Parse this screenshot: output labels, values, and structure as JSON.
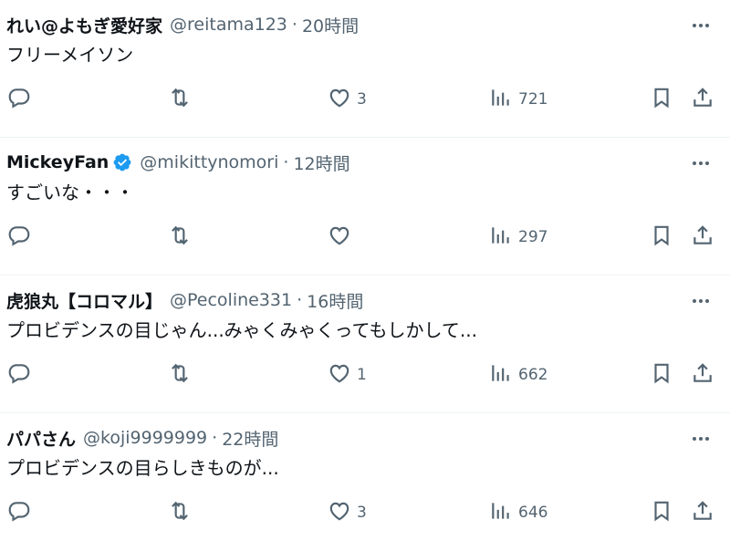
{
  "replies": [
    {
      "name": "れい@よもぎ愛好家",
      "verified": false,
      "handle": "@reitama123",
      "time": "20時間",
      "text": "フリーメイソン",
      "likes": "3",
      "views": "721"
    },
    {
      "name": "MickeyFan",
      "verified": true,
      "handle": "@mikittynomori",
      "time": "12時間",
      "text": "すごいな・・・",
      "likes": "",
      "views": "297"
    },
    {
      "name": "虎狼丸【コロマル】",
      "verified": false,
      "handle": "@Pecoline331",
      "time": "16時間",
      "text": "プロビデンスの目じゃん...みゃくみゃくってもしかして...",
      "likes": "1",
      "views": "662"
    },
    {
      "name": "パパさん",
      "verified": false,
      "handle": "@koji9999999",
      "time": "22時間",
      "text": "プロビデンスの目らしきものが...",
      "likes": "3",
      "views": "646"
    }
  ],
  "separator": "·",
  "colors": {
    "text": "#0f1419",
    "muted": "#536471",
    "verified": "#1d9bf0",
    "divider": "#eff3f4"
  },
  "icons": {
    "more": "more-icon",
    "reply": "reply-icon",
    "retweet": "retweet-icon",
    "like": "heart-icon",
    "views": "views-icon",
    "bookmark": "bookmark-icon",
    "share": "share-icon",
    "verified": "verified-badge-icon"
  }
}
